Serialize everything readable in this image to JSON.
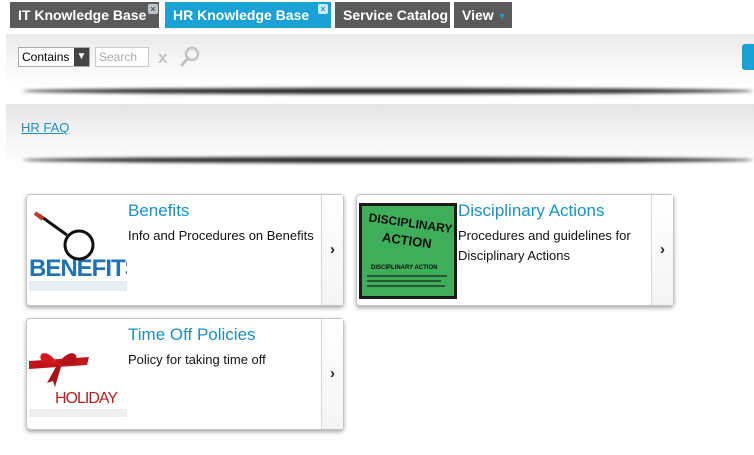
{
  "tabs": [
    {
      "label": "IT Knowledge Base",
      "closable": true,
      "active": false
    },
    {
      "label": "HR Knowledge Base",
      "closable": true,
      "active": true
    },
    {
      "label": "Service Catalog",
      "closable": false,
      "active": false
    },
    {
      "label": "View",
      "closable": false,
      "active": false,
      "has_dropdown": true
    }
  ],
  "search": {
    "mode": "Contains",
    "placeholder": "Search",
    "value": "",
    "clear_glyph": "x",
    "icon": "magnifier-icon"
  },
  "breadcrumb": {
    "label": "HR FAQ"
  },
  "cards": [
    {
      "title": "Benefits",
      "description": "Info and Procedures on Benefits",
      "image_text": "BENEFITS",
      "icon": "benefits-magnifier-image"
    },
    {
      "title": "Disciplinary Actions",
      "description": "Procedures and guidelines for Disciplinary Actions",
      "image_text_line1": "DISCIPLINARY",
      "image_text_line2": "ACTION",
      "image_text_line3": "DISCIPLINARY ACTION",
      "icon": "disciplinary-sign-image"
    },
    {
      "title": "Time Off Policies",
      "description": "Policy for taking time off",
      "image_text": "HOLIDAY",
      "icon": "holiday-ribbon-image"
    }
  ],
  "colors": {
    "tab_dark": "#5a5a5a",
    "tab_active": "#1aa1d6",
    "link": "#1a8fc9"
  }
}
